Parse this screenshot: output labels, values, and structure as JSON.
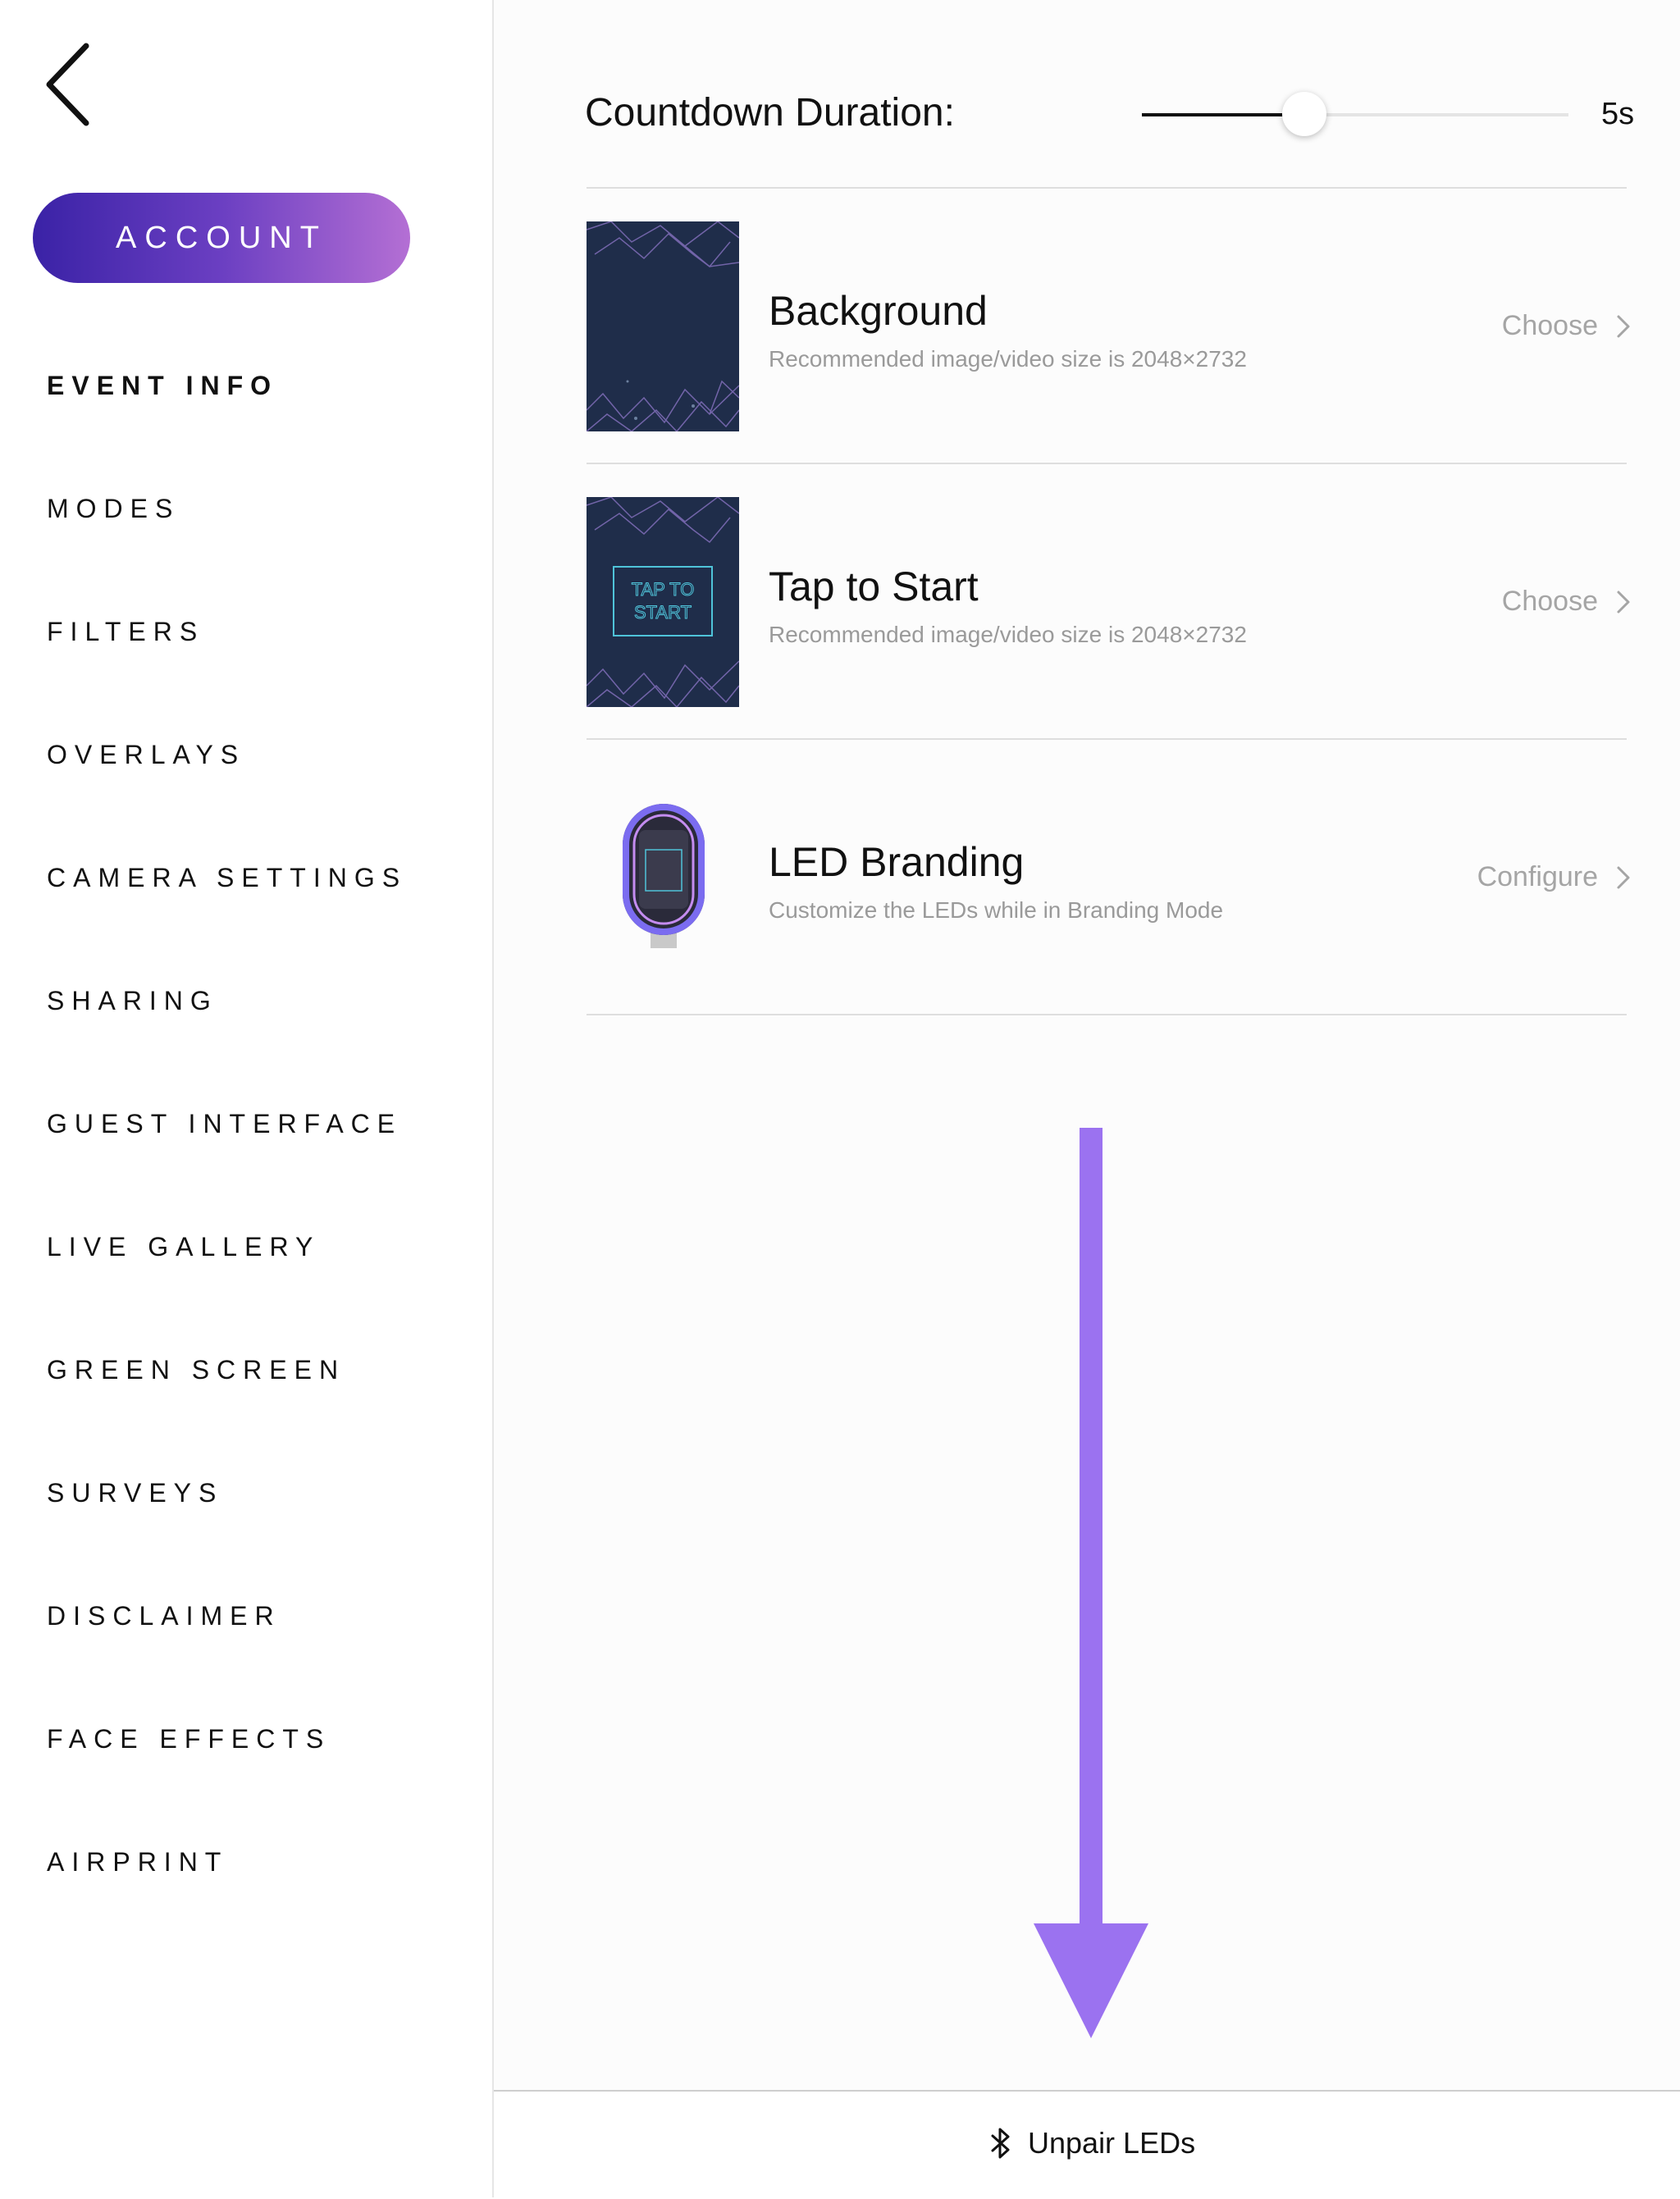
{
  "sidebar": {
    "account_label": "ACCOUNT",
    "items": [
      {
        "label": "EVENT INFO",
        "active": true
      },
      {
        "label": "MODES"
      },
      {
        "label": "FILTERS"
      },
      {
        "label": "OVERLAYS"
      },
      {
        "label": "CAMERA SETTINGS"
      },
      {
        "label": "SHARING"
      },
      {
        "label": "GUEST INTERFACE"
      },
      {
        "label": "LIVE GALLERY"
      },
      {
        "label": "GREEN SCREEN"
      },
      {
        "label": "SURVEYS"
      },
      {
        "label": "DISCLAIMER"
      },
      {
        "label": "FACE EFFECTS"
      },
      {
        "label": "AIRPRINT"
      }
    ]
  },
  "countdown": {
    "label": "Countdown Duration:",
    "value_text": "5s",
    "fraction": 0.38
  },
  "rows": [
    {
      "title": "Background",
      "subtitle": "Recommended image/video size is 2048×2732",
      "action": "Choose"
    },
    {
      "title": "Tap to Start",
      "subtitle": "Recommended image/video size is 2048×2732",
      "action": "Choose",
      "thumb_text": [
        "TAP TO",
        "START"
      ]
    },
    {
      "title": "LED Branding",
      "subtitle": "Customize the LEDs while in Branding Mode",
      "action": "Configure"
    }
  ],
  "bottom": {
    "unpair_label": "Unpair LEDs",
    "icon": "bluetooth-icon"
  },
  "colors": {
    "accent_gradient": [
      "#3a22a6",
      "#b46fd4"
    ],
    "arrow": "#9b72f0"
  }
}
